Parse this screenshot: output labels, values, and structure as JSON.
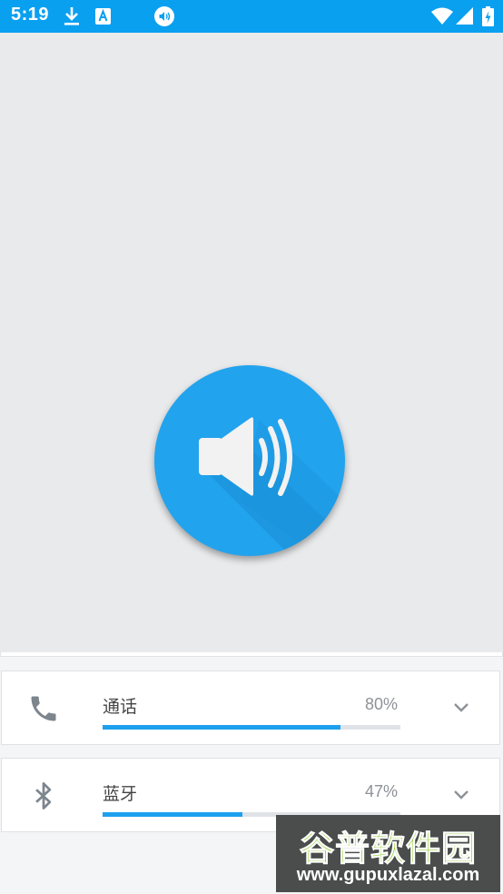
{
  "status_bar": {
    "time": "5:19",
    "left_icons": [
      "download-icon",
      "a-badge-icon",
      "volume-notification-icon"
    ],
    "right_icons": [
      "wifi-icon",
      "signal-icon",
      "battery-charging-icon"
    ]
  },
  "hero": {
    "icon": "speaker-volume-icon",
    "accent_color": "#22a3ee"
  },
  "streams": [
    {
      "label": "通话",
      "percent_text": "80%",
      "level": 0.8,
      "icon": "phone-icon"
    },
    {
      "label": "蓝牙",
      "percent_text": "47%",
      "level": 0.47,
      "icon": "bluetooth-icon"
    }
  ],
  "watermark": {
    "title": "谷普软件园",
    "url": "www.gupuxlazal.com"
  },
  "colors": {
    "status_bar": "#0aa0f0",
    "slider_fill": "#1da0ee",
    "slider_track": "#dfe3e7"
  }
}
